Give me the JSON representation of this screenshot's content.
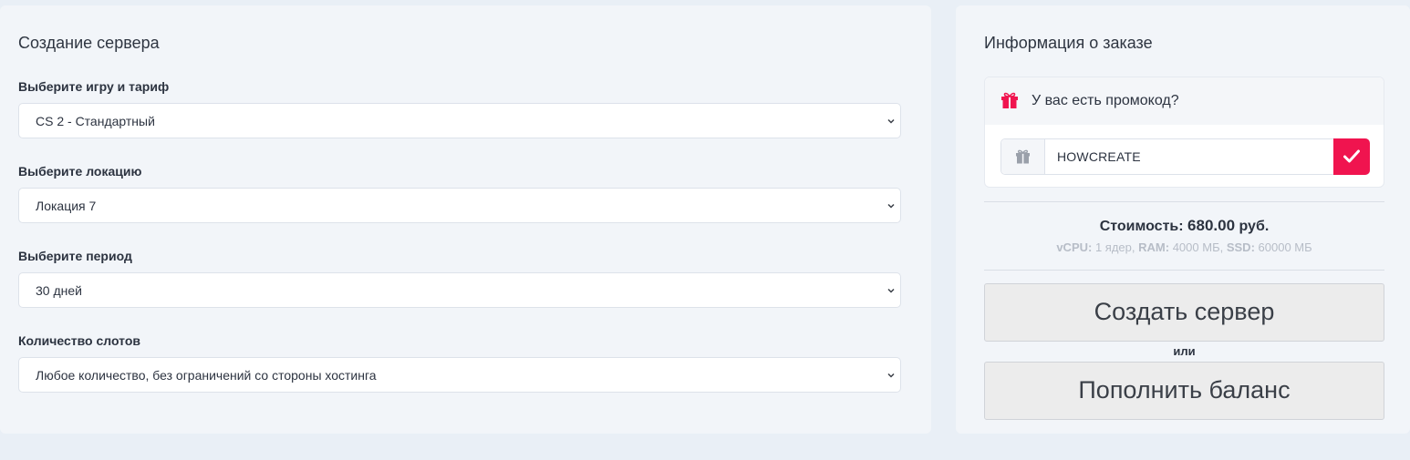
{
  "left_panel": {
    "title": "Создание сервера",
    "fields": [
      {
        "label": "Выберите игру и тариф",
        "value": "CS 2 - Стандартный"
      },
      {
        "label": "Выберите локацию",
        "value": "Локация 7"
      },
      {
        "label": "Выберите период",
        "value": "30 дней"
      },
      {
        "label": "Количество слотов",
        "value": "Любое количество, без ограничений со стороны хостинга"
      }
    ]
  },
  "right_panel": {
    "title": "Информация о заказе",
    "promo": {
      "question": "У вас есть промокод?",
      "code_value": "HOWCREATE",
      "icon": "gift-icon",
      "apply_icon": "check-icon"
    },
    "cost": {
      "label": "Стоимость:",
      "amount": "680.00",
      "currency": "руб."
    },
    "specs": {
      "vcpu_label": "vCPU:",
      "vcpu_value": "1 ядер,",
      "ram_label": "RAM:",
      "ram_value": "4000 МБ,",
      "ssd_label": "SSD:",
      "ssd_value": "60000 МБ"
    },
    "create_button": "Создать сервер",
    "or_text": "или",
    "topup_button": "Пополнить баланс"
  },
  "colors": {
    "accent": "#f0144f",
    "page_bg": "#e9eff6",
    "panel_bg": "#f2f5f9"
  }
}
